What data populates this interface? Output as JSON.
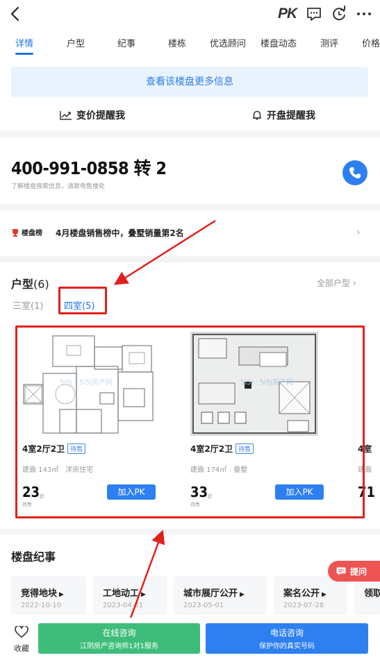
{
  "topbar": {
    "back_icon": "back-chevron-icon",
    "pk_label": "PK",
    "icons": [
      "comment-icon",
      "refresh-icon",
      "more-icon"
    ]
  },
  "tabs": [
    "详情",
    "户型",
    "纪事",
    "楼栋",
    "优选顾问",
    "楼盘动态",
    "测评",
    "价格"
  ],
  "info": {
    "more_button": "查看该楼盘更多信息",
    "price_alert": "变价提醒我",
    "open_alert": "开盘提醒我"
  },
  "phone": {
    "number": "400-991-0858 转 2",
    "note": "了解楼盘搜索信息，请致电售楼处"
  },
  "rank": {
    "logo": "楼盘榜",
    "text": "4月楼盘销售榜中，叠墅销量第2名"
  },
  "layouts": {
    "title": "户型",
    "count": "(6)",
    "all_link": "全部户型 ›",
    "subtabs": [
      "三室(1)",
      "四室(5)"
    ],
    "cards": [
      {
        "title": "4室2厅2卫",
        "badge": "待售",
        "area": "建面 143㎡",
        "type": "洋房住宅",
        "num": "23",
        "sub": "待售",
        "pk": "加入PK"
      },
      {
        "title": "4室2厅2卫",
        "badge": "待售",
        "area": "建面 174㎡",
        "type": "叠墅",
        "num": "33",
        "sub": "待售",
        "pk": "加入PK"
      },
      {
        "title": "4室",
        "area": "建面",
        "num": "71"
      }
    ]
  },
  "history": {
    "title": "楼盘纪事",
    "events": [
      {
        "name": "竞得地块",
        "date": "2022-10-10"
      },
      {
        "name": "工地动工",
        "date": "2023-04-21"
      },
      {
        "name": "城市展厅公开",
        "date": "2023-05-01"
      },
      {
        "name": "案名公开",
        "date": "2023-07-28"
      },
      {
        "name": "领取"
      }
    ]
  },
  "float_ask": "提问",
  "bottom": {
    "fav_label": "收藏",
    "online": {
      "main": "在线咨询",
      "sub": "江阴房产咨询师1对1服务"
    },
    "call": {
      "main": "电话咨询",
      "sub": "保护你的真实号码"
    }
  },
  "colors": {
    "accent": "#1b74e8",
    "annotation_red": "#e0201c",
    "online_green": "#3ebd7a",
    "call_blue": "#2e7ff0"
  }
}
